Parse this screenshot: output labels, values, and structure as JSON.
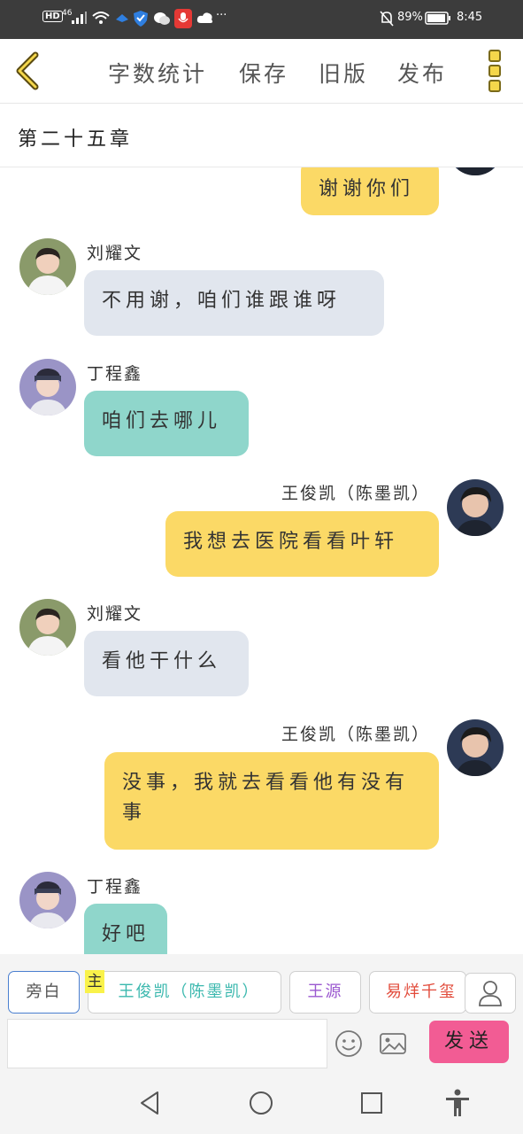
{
  "status_bar": {
    "hd": "HD",
    "network": "46",
    "battery_percent": "89%",
    "time": "8:45",
    "more": "···"
  },
  "toolbar": {
    "word_count": "字数统计",
    "save": "保存",
    "old_version": "旧版",
    "publish": "发布"
  },
  "chapter": {
    "title": "第二十五章"
  },
  "messages": [
    {
      "side": "right",
      "speaker": "",
      "text": "谢谢你们",
      "color": "#fbd966"
    },
    {
      "side": "left",
      "speaker": "刘耀文",
      "text": "不用谢，咱们谁跟谁呀",
      "color": "#e1e6ee"
    },
    {
      "side": "left",
      "speaker": "丁程鑫",
      "text": "咱们去哪儿",
      "color": "#8fd6cb"
    },
    {
      "side": "right",
      "speaker": "王俊凯（陈墨凯）",
      "text": "我想去医院看看叶轩",
      "color": "#fbd966"
    },
    {
      "side": "left",
      "speaker": "刘耀文",
      "text": "看他干什么",
      "color": "#e1e6ee"
    },
    {
      "side": "right",
      "speaker": "王俊凯（陈墨凯）",
      "text": "没事，我就去看看他有没有事",
      "color": "#fbd966"
    },
    {
      "side": "left",
      "speaker": "丁程鑫",
      "text": "好吧",
      "color": "#8fd6cb"
    }
  ],
  "roles": {
    "narration": "旁白",
    "main_tag": "主",
    "role1": "王俊凯（陈墨凯）",
    "role2": "王源",
    "role3": "易烊千玺"
  },
  "composer": {
    "input_value": "",
    "send": "发送"
  },
  "colors": {
    "accent": "#f5d74b",
    "send_button": "#f25c94",
    "role1": "#3bb8ae",
    "role2": "#9b59d0",
    "role3": "#e24b3b"
  },
  "icons": [
    "back-chevron-icon",
    "more-vertical-icon",
    "person-icon",
    "emoji-icon",
    "image-icon",
    "nav-back-icon",
    "nav-home-icon",
    "nav-recents-icon",
    "accessibility-icon"
  ]
}
